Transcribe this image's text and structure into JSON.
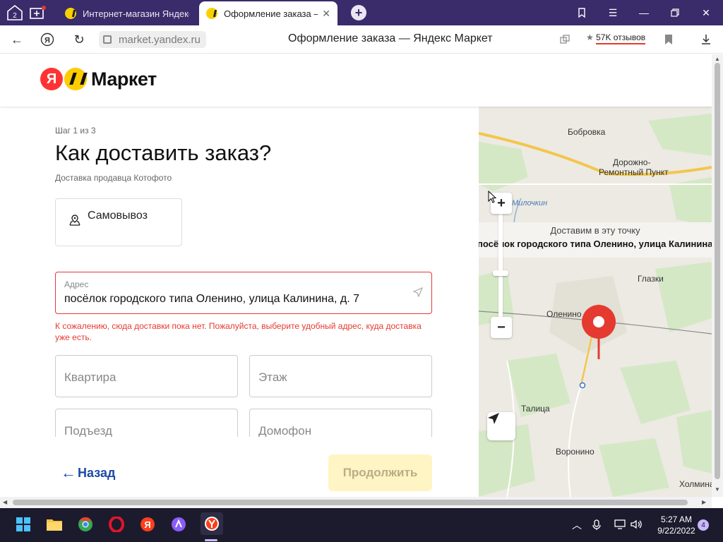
{
  "browser": {
    "tab_counter": "2",
    "tabs": [
      {
        "label": "Интернет-магазин Яндекс Маркет",
        "active": false
      },
      {
        "label": "Оформление заказа — Яндекс Маркет",
        "active": true
      }
    ],
    "url": "market.yandex.ru",
    "page_title": "Оформление заказа — Яндекс Маркет",
    "reviews_label": "57K отзывов",
    "theme_color": "#3a2b6b"
  },
  "site": {
    "logo_letter": "Я",
    "logo_text": "Маркет"
  },
  "checkout": {
    "step": "Шаг 1 из 3",
    "title": "Как доставить заказ?",
    "seller": "Доставка продавца Котофото",
    "pickup_label": "Самовывоз",
    "address_label": "Адрес",
    "address_value": "посёлок городского типа Оленино, улица Калинина, д. 7",
    "error": "К сожалению, сюда доставки пока нет. Пожалуйста, выберите удобный адрес, куда доставка уже есть.",
    "fields": {
      "apartment": "Квартира",
      "floor": "Этаж",
      "entrance": "Подъезд",
      "intercom": "Домофон"
    },
    "back_label": "Назад",
    "continue_label": "Продолжить",
    "error_color": "#e53a2f",
    "accent_color": "#ffd600"
  },
  "map": {
    "deliver_here": "Доставим в эту точку",
    "point_address": "посёлок городского типа Оленино, улица Калинина",
    "places": [
      "Бобровка",
      "Дорожно-",
      "Ремонтный Пункт",
      "Милочкин",
      "Глазки",
      "Оленино",
      "Талица",
      "Воронино",
      "Холмина"
    ],
    "zoom_in": "+",
    "zoom_out": "−"
  },
  "taskbar": {
    "time": "5:27 AM",
    "date": "9/22/2022",
    "notifications": "4"
  }
}
